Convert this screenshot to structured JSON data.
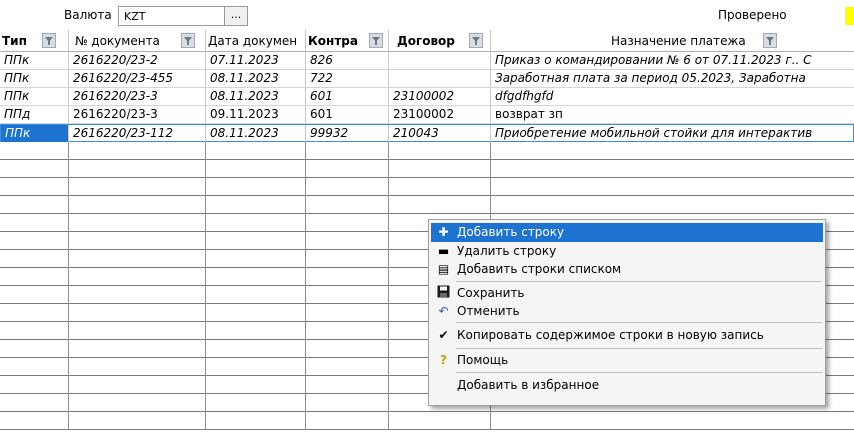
{
  "toolbar": {
    "currency_label": "Валюта",
    "currency_value": "KZT",
    "currency_ellipsis": "...",
    "checked_label": "Проверено",
    "checked_color": "#ffff00"
  },
  "table": {
    "headers": {
      "type": "Тип",
      "doc_no": "№ документа",
      "doc_date": "Дата докумен",
      "counterparty": "Контра",
      "contract": "Договор",
      "purpose": "Назначение платежа"
    },
    "rows": [
      {
        "type": "ППк",
        "doc_no": "2616220/23-2",
        "doc_date": "07.11.2023",
        "counterparty": "826",
        "contract": "",
        "purpose": "Приказ о командировании № 6 от 07.11.2023 г.. С"
      },
      {
        "type": "ППк",
        "doc_no": "2616220/23-455",
        "doc_date": "08.11.2023",
        "counterparty": "722",
        "contract": "",
        "purpose": "Заработная плата за период 05.2023, Заработна"
      },
      {
        "type": "ППк",
        "doc_no": "2616220/23-3",
        "doc_date": "08.11.2023",
        "counterparty": "601",
        "contract": "23100002",
        "purpose": "dfgdfhgfd"
      },
      {
        "type": "ППд",
        "doc_no": "2616220/23-3",
        "doc_date": "09.11.2023",
        "counterparty": "601",
        "contract": "23100002",
        "purpose": "возврат зп"
      },
      {
        "type": "ППк",
        "doc_no": "2616220/23-112",
        "doc_date": "08.11.2023",
        "counterparty": "99932",
        "contract": "210043",
        "purpose": "Приобретение мобильной стойки для интерактив"
      }
    ]
  },
  "context_menu": {
    "add_row": "Добавить строку",
    "delete_row": "Удалить строку",
    "add_rows_list": "Добавить строки списком",
    "save": "Сохранить",
    "cancel": "Отменить",
    "copy_row": "Копировать содержимое строки в новую запись",
    "help": "Помощь",
    "add_favorite": "Добавить в избранное",
    "highlight_color": "#1e73d0"
  }
}
